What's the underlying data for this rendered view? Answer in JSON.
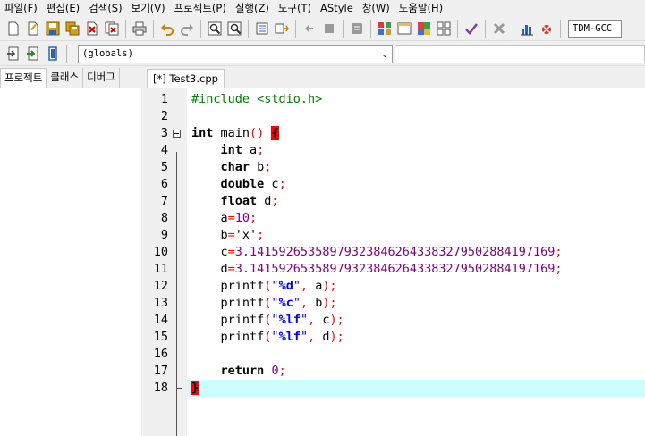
{
  "menu": [
    "파일(F)",
    "편집(E)",
    "검색(S)",
    "보기(V)",
    "프로젝트(P)",
    "실행(Z)",
    "도구(T)",
    "AStyle",
    "창(W)",
    "도움말(H)"
  ],
  "toolbar": {
    "compiler": "TDM-GCC",
    "icons": [
      "new-file-icon",
      "open-file-icon",
      "save-icon",
      "save-all-icon",
      "close-icon",
      "close-all-icon",
      "print-icon",
      "undo-icon",
      "redo-icon",
      "find-icon",
      "replace-icon",
      "indent-icon",
      "unindent-icon",
      "bookmark-back-icon",
      "bookmark-forward-icon",
      "toggle-comment-icon",
      "layout-grid-icon",
      "window-icon",
      "color-grid-icon",
      "grid-icon",
      "check-icon",
      "stop-icon",
      "chart-icon",
      "debug-icon"
    ]
  },
  "toolbar2": {
    "globals": "(globals)"
  },
  "left_tabs": [
    "프로젝트",
    "클래스",
    "디버그"
  ],
  "editor": {
    "tab_title": "[*] Test3.cpp",
    "lines": [
      {
        "n": "1",
        "tokens": [
          {
            "c": "pp",
            "t": "#include <stdio.h>"
          }
        ]
      },
      {
        "n": "2",
        "tokens": []
      },
      {
        "n": "3",
        "tokens": [
          {
            "c": "kw",
            "t": "int"
          },
          {
            "c": "id",
            "t": " main"
          },
          {
            "c": "sym",
            "t": "()"
          },
          {
            "c": "id",
            "t": " "
          },
          {
            "c": "brace-hl",
            "t": "{"
          }
        ]
      },
      {
        "n": "4",
        "tokens": [
          {
            "c": "id",
            "t": "    "
          },
          {
            "c": "kw",
            "t": "int"
          },
          {
            "c": "id",
            "t": " a"
          },
          {
            "c": "sym",
            "t": ";"
          }
        ]
      },
      {
        "n": "5",
        "tokens": [
          {
            "c": "id",
            "t": "    "
          },
          {
            "c": "kw",
            "t": "char"
          },
          {
            "c": "id",
            "t": " b"
          },
          {
            "c": "sym",
            "t": ";"
          }
        ]
      },
      {
        "n": "6",
        "tokens": [
          {
            "c": "id",
            "t": "    "
          },
          {
            "c": "kw",
            "t": "double"
          },
          {
            "c": "id",
            "t": " c"
          },
          {
            "c": "sym",
            "t": ";"
          }
        ]
      },
      {
        "n": "7",
        "tokens": [
          {
            "c": "id",
            "t": "    "
          },
          {
            "c": "kw",
            "t": "float"
          },
          {
            "c": "id",
            "t": " d"
          },
          {
            "c": "sym",
            "t": ";"
          }
        ]
      },
      {
        "n": "8",
        "tokens": [
          {
            "c": "id",
            "t": "    a"
          },
          {
            "c": "sym",
            "t": "="
          },
          {
            "c": "num",
            "t": "10"
          },
          {
            "c": "sym",
            "t": ";"
          }
        ]
      },
      {
        "n": "9",
        "tokens": [
          {
            "c": "id",
            "t": "    b"
          },
          {
            "c": "sym",
            "t": "="
          },
          {
            "c": "id",
            "t": "'x'"
          },
          {
            "c": "sym",
            "t": ";"
          }
        ]
      },
      {
        "n": "10",
        "tokens": [
          {
            "c": "id",
            "t": "    c"
          },
          {
            "c": "sym",
            "t": "="
          },
          {
            "c": "num",
            "t": "3.14159265358979323846264338327950288419716"
          },
          {
            "c": "num",
            "t": "9"
          },
          {
            "c": "sym",
            "t": ";"
          }
        ]
      },
      {
        "n": "11",
        "tokens": [
          {
            "c": "id",
            "t": "    d"
          },
          {
            "c": "sym",
            "t": "="
          },
          {
            "c": "num",
            "t": "3.14159265358979323846264338327950288419716"
          },
          {
            "c": "num",
            "t": "9"
          },
          {
            "c": "sym",
            "t": ";"
          }
        ]
      },
      {
        "n": "12",
        "tokens": [
          {
            "c": "id",
            "t": "    printf"
          },
          {
            "c": "sym",
            "t": "("
          },
          {
            "c": "str",
            "t": "\""
          },
          {
            "c": "strf",
            "t": "%d"
          },
          {
            "c": "str",
            "t": "\""
          },
          {
            "c": "sym",
            "t": ","
          },
          {
            "c": "id",
            "t": " a"
          },
          {
            "c": "sym",
            "t": ");"
          }
        ]
      },
      {
        "n": "13",
        "tokens": [
          {
            "c": "id",
            "t": "    printf"
          },
          {
            "c": "sym",
            "t": "("
          },
          {
            "c": "str",
            "t": "\""
          },
          {
            "c": "strf",
            "t": "%c"
          },
          {
            "c": "str",
            "t": "\""
          },
          {
            "c": "sym",
            "t": ","
          },
          {
            "c": "id",
            "t": " b"
          },
          {
            "c": "sym",
            "t": ");"
          }
        ]
      },
      {
        "n": "14",
        "tokens": [
          {
            "c": "id",
            "t": "    printf"
          },
          {
            "c": "sym",
            "t": "("
          },
          {
            "c": "str",
            "t": "\""
          },
          {
            "c": "strf",
            "t": "%lf"
          },
          {
            "c": "str",
            "t": "\""
          },
          {
            "c": "sym",
            "t": ","
          },
          {
            "c": "id",
            "t": " c"
          },
          {
            "c": "sym",
            "t": ");"
          }
        ]
      },
      {
        "n": "15",
        "tokens": [
          {
            "c": "id",
            "t": "    printf"
          },
          {
            "c": "sym",
            "t": "("
          },
          {
            "c": "str",
            "t": "\""
          },
          {
            "c": "strf",
            "t": "%lf"
          },
          {
            "c": "str",
            "t": "\""
          },
          {
            "c": "sym",
            "t": ","
          },
          {
            "c": "id",
            "t": " d"
          },
          {
            "c": "sym",
            "t": ");"
          }
        ]
      },
      {
        "n": "16",
        "tokens": []
      },
      {
        "n": "17",
        "tokens": [
          {
            "c": "id",
            "t": "    "
          },
          {
            "c": "kw",
            "t": "return"
          },
          {
            "c": "id",
            "t": " "
          },
          {
            "c": "num",
            "t": "0"
          },
          {
            "c": "sym",
            "t": ";"
          }
        ]
      },
      {
        "n": "18",
        "tokens": [
          {
            "c": "brace-hl",
            "t": "}"
          }
        ]
      }
    ]
  },
  "colors": {
    "preprocessor": "#008000",
    "symbol": "#ff0000",
    "number": "#800080",
    "string": "#0000ff",
    "current_line": "#ccffff",
    "brace_match": "#ff0000"
  }
}
